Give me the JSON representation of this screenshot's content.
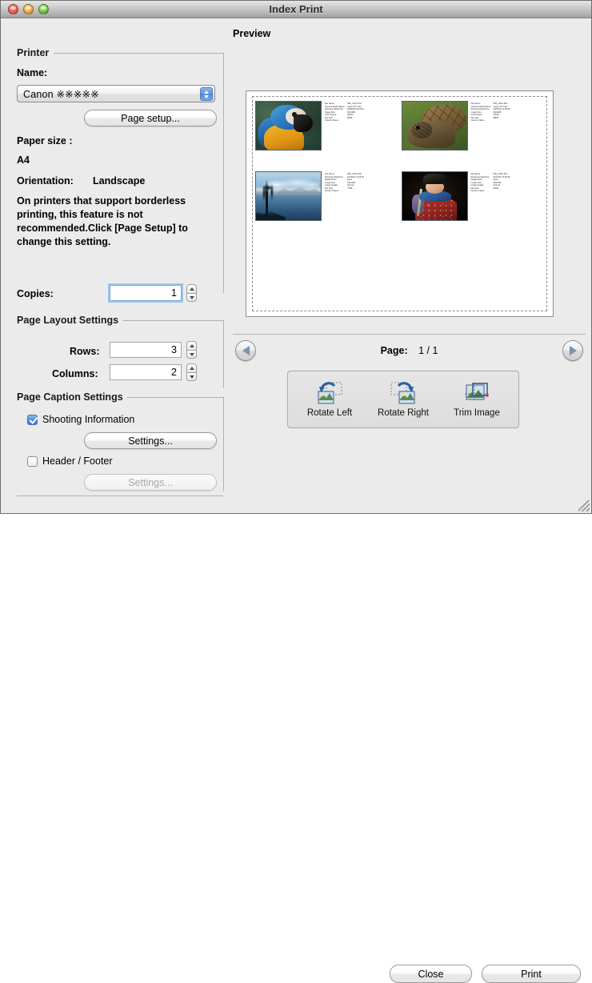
{
  "window": {
    "title": "Index Print",
    "traffic": [
      "close-button",
      "minimize-button",
      "zoom-button"
    ]
  },
  "printer": {
    "group_label": "Printer",
    "name_label": "Name:",
    "selected_printer": "Canon ※※※※※",
    "page_setup_button": "Page setup...",
    "paper_size_label": "Paper size :",
    "paper_size_value": "A4",
    "orientation_label": "Orientation:",
    "orientation_value": "Landscape",
    "note": "On printers that support borderless printing, this feature is not recommended.Click [Page Setup] to change this setting.",
    "copies_label": "Copies:",
    "copies_value": "1"
  },
  "page_layout": {
    "group_label": "Page Layout Settings",
    "rows_label": "Rows:",
    "rows_value": "3",
    "columns_label": "Columns:",
    "columns_value": "2"
  },
  "page_caption": {
    "group_label": "Page Caption Settings",
    "shooting_information_label": "Shooting Information",
    "shooting_information_checked": true,
    "shooting_settings_button": "Settings...",
    "header_footer_label": "Header / Footer",
    "header_footer_checked": false,
    "header_footer_settings_button": "Settings...",
    "header_footer_settings_disabled": true
  },
  "preview": {
    "title": "Preview",
    "page_label": "Page:",
    "page_value": "1 / 1",
    "prev_icon": "left-triangle-icon",
    "next_icon": "right-triangle-icon",
    "cells": [
      {
        "art": "art-macaw",
        "alt": "blue-and-gold-macaw-thumbnail",
        "fields": [
          {
            "key": "File Name",
            "value": "IMG_0101.JPG"
          },
          {
            "key": "Camera Model Name",
            "value": "Canon DV G13"
          },
          {
            "key": "Shooting Date/Time",
            "value": "03/25/02 09:20:16"
          },
          {
            "key": "Image Size",
            "value": "640x480"
          },
          {
            "key": "Color Space",
            "value": "sRGB"
          },
          {
            "key": "File Size",
            "value": "80KB"
          },
          {
            "key": "Owner's Name",
            "value": ":"
          }
        ]
      },
      {
        "art": "art-tortoise",
        "alt": "giant-tortoise-thumbnail",
        "fields": [
          {
            "key": "File Name",
            "value": "IMG_0102.JPG"
          },
          {
            "key": "Camera Model Name",
            "value": "Canon DV G13"
          },
          {
            "key": "Shooting Date/Time",
            "value": "03/25/02 11:28:28"
          },
          {
            "key": "Image Size",
            "value": "640x480"
          },
          {
            "key": "Color Space",
            "value": "sRGB"
          },
          {
            "key": "File Size",
            "value": "88KB"
          },
          {
            "key": "Owner's Name",
            "value": ":"
          }
        ]
      },
      {
        "art": "art-lake",
        "alt": "lake-and-mountain-thumbnail",
        "fields": [
          {
            "key": "File Name",
            "value": "IMG_0103.JPG"
          },
          {
            "key": "Shooting Date/Time",
            "value": "01/15/02 14:35:25"
          },
          {
            "key": "Digital Zoom",
            "value": "None"
          },
          {
            "key": "Image Size",
            "value": "640x480"
          },
          {
            "key": "Image Quality",
            "value": "Normal"
          },
          {
            "key": "File Size",
            "value": "77KB"
          },
          {
            "key": "Owner's Name",
            "value": ":"
          }
        ]
      },
      {
        "art": "art-child",
        "alt": "child-in-costume-thumbnail",
        "fields": [
          {
            "key": "File Name",
            "value": "IMG_0104.JPG"
          },
          {
            "key": "Shooting Date/Time",
            "value": "01/15/02 14:35:28"
          },
          {
            "key": "Digital Zoom",
            "value": "None"
          },
          {
            "key": "Image Size",
            "value": "640x480"
          },
          {
            "key": "Image Quality",
            "value": "Normal"
          },
          {
            "key": "File Size",
            "value": "64KB"
          },
          {
            "key": "Owner's Name",
            "value": ":"
          }
        ]
      }
    ]
  },
  "tools": [
    {
      "label": "Rotate Left",
      "icon": "rotate-left-icon"
    },
    {
      "label": "Rotate Right",
      "icon": "rotate-right-icon"
    },
    {
      "label": "Trim Image",
      "icon": "trim-image-icon"
    }
  ],
  "footer": {
    "close_button": "Close",
    "print_button": "Print"
  },
  "colors": {
    "window_bg": "#ebebeb",
    "accent_blue": "#4a86d6",
    "sheet_bg": "#ffffff",
    "rule": "#b0b0b0"
  }
}
